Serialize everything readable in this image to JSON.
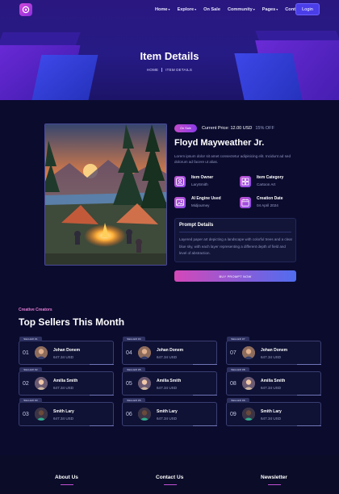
{
  "colors": {
    "accent": "#4b3ee8",
    "badge": "#c44ccb",
    "page_bg": "#0b0b2e",
    "hero_bg": "#261a84"
  },
  "header": {
    "logo_icon": "brand-logo-icon",
    "nav": [
      {
        "label": "Home",
        "dropdown": true
      },
      {
        "label": "Explore",
        "dropdown": true
      },
      {
        "label": "On Sale",
        "dropdown": false
      },
      {
        "label": "Community",
        "dropdown": true
      },
      {
        "label": "Pages",
        "dropdown": true
      },
      {
        "label": "Contact",
        "dropdown": false
      }
    ],
    "login": "Login"
  },
  "hero": {
    "title": "Item Details",
    "breadcrumb": [
      "HOME",
      "ITEM DETAILS"
    ]
  },
  "item": {
    "badge": "On Sale",
    "price": "Current Price: 12.00 USD",
    "discount": "15% OFF",
    "name": "Floyd Mayweather Jr.",
    "description": "Lorem ipsum dolor sit amet consectetur adipisicing elit. Incidunt ad sed dolorum ad facere ut alias.",
    "meta": [
      {
        "label": "Item Owner",
        "value": "LarySmith",
        "icon": "user-icon"
      },
      {
        "label": "Item Category",
        "value": "Cartoon Art",
        "icon": "grid-icon"
      },
      {
        "label": "AI Engine Used",
        "value": "Midjourney",
        "icon": "image-icon"
      },
      {
        "label": "Creation Date",
        "value": "04 April 2024",
        "icon": "calendar-icon"
      }
    ],
    "prompt_title": "Prompt Details",
    "prompt_text": "Layered paper art depicting a landscape with colorful trees and a clear blue sky, with each layer representing a different depth of field and level of abstraction.",
    "buy": "BUY PROMPT NOW"
  },
  "sellers": {
    "subtitle": "Creative Creators",
    "title": "Top Sellers This Month",
    "cards": [
      {
        "tag": "SELLER #1",
        "rank": "01",
        "name": "Johan Donem",
        "amount": "647.34 USD"
      },
      {
        "tag": "SELLER #2",
        "rank": "02",
        "name": "Amilia Smith",
        "amount": "647.34 USD"
      },
      {
        "tag": "SELLER #3",
        "rank": "03",
        "name": "Smith Lary",
        "amount": "647.34 USD"
      },
      {
        "tag": "SELLER #4",
        "rank": "04",
        "name": "Johan Donem",
        "amount": "647.34 USD"
      },
      {
        "tag": "SELLER #5",
        "rank": "05",
        "name": "Amilia Smith",
        "amount": "647.34 USD"
      },
      {
        "tag": "SELLER #6",
        "rank": "06",
        "name": "Smith Lary",
        "amount": "647.34 USD"
      },
      {
        "tag": "SELLER #7",
        "rank": "07",
        "name": "Johan Donem",
        "amount": "647.34 USD"
      },
      {
        "tag": "SELLER #8",
        "rank": "08",
        "name": "Amilia Smith",
        "amount": "647.34 USD"
      },
      {
        "tag": "SELLER #9",
        "rank": "09",
        "name": "Smith Lary",
        "amount": "647.34 USD"
      }
    ]
  },
  "footer": {
    "columns": [
      "About Us",
      "Contact Us",
      "Newsletter"
    ]
  }
}
